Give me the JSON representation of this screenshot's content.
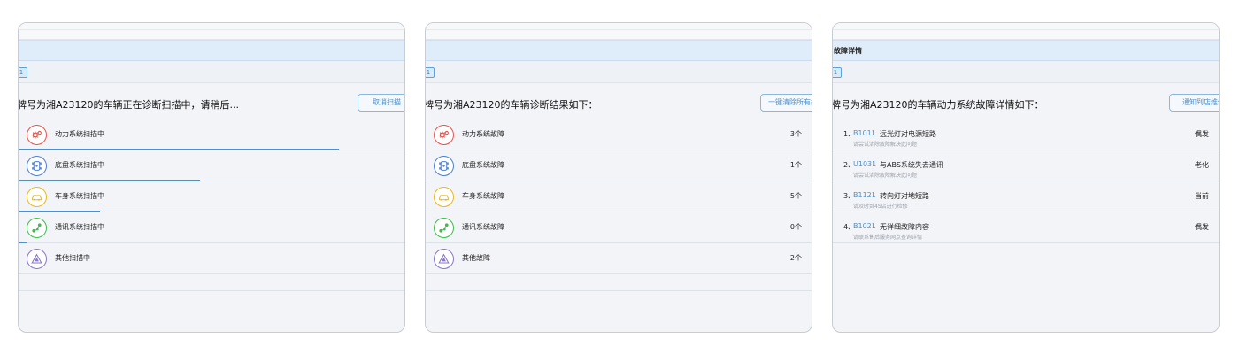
{
  "panel1": {
    "title": "牌号为湘A23120的车辆正在诊断扫描中，请稍后...",
    "action_label": "取消扫描",
    "tag": "1",
    "rows": [
      {
        "label": "动力系统扫描中",
        "icon": "gear-icon",
        "progress": 0.83
      },
      {
        "label": "底盘系统扫描中",
        "icon": "chassis-icon",
        "progress": 0.47
      },
      {
        "label": "车身系统扫描中",
        "icon": "car-body-icon",
        "progress": 0.21
      },
      {
        "label": "通讯系统扫描中",
        "icon": "network-icon",
        "progress": 0.02
      },
      {
        "label": "其他扫描中",
        "icon": "warning-triangle-icon",
        "progress": 0
      }
    ]
  },
  "panel2": {
    "title": "牌号为湘A23120的车辆诊断结果如下：",
    "action_label": "一键清除所有故",
    "tag": "1",
    "rows": [
      {
        "label": "动力系统故障",
        "count": "3个",
        "icon": "gear-icon"
      },
      {
        "label": "底盘系统故障",
        "count": "1个",
        "icon": "chassis-icon"
      },
      {
        "label": "车身系统故障",
        "count": "5个",
        "icon": "car-body-icon"
      },
      {
        "label": "通讯系统故障",
        "count": "0个",
        "icon": "network-icon"
      },
      {
        "label": "其他故障",
        "count": "2个",
        "icon": "warning-triangle-icon"
      }
    ]
  },
  "panel3": {
    "header": "故障详情",
    "title": "牌号为湘A23120的车辆动力系统故障详情如下：",
    "action_label": "通知到店维修",
    "tag": "1",
    "rows": [
      {
        "num": "1、",
        "code": "B1011",
        "desc": "远光灯对电源短路",
        "hint": "请尝试清除故障解决此问题",
        "status": "偶发"
      },
      {
        "num": "2、",
        "code": "U1031",
        "desc": "与ABS系统失去通讯",
        "hint": "请尝试清除故障解决此问题",
        "status": "老化"
      },
      {
        "num": "3、",
        "code": "B1121",
        "desc": "转向灯对地短路",
        "hint": "请及时到4S店进行检修",
        "status": "当前"
      },
      {
        "num": "4、",
        "code": "B1021",
        "desc": "无详细故障内容",
        "hint": "请联系售后服务网点查询详情",
        "status": "偶发"
      }
    ]
  },
  "colors": {
    "accent": "#4d8fc9",
    "header_bg": "#deedf9",
    "red": "#e8524a",
    "blue": "#4a7fd4",
    "yellow": "#e8b820",
    "green": "#3bc14a",
    "purple": "#8a76c9"
  }
}
